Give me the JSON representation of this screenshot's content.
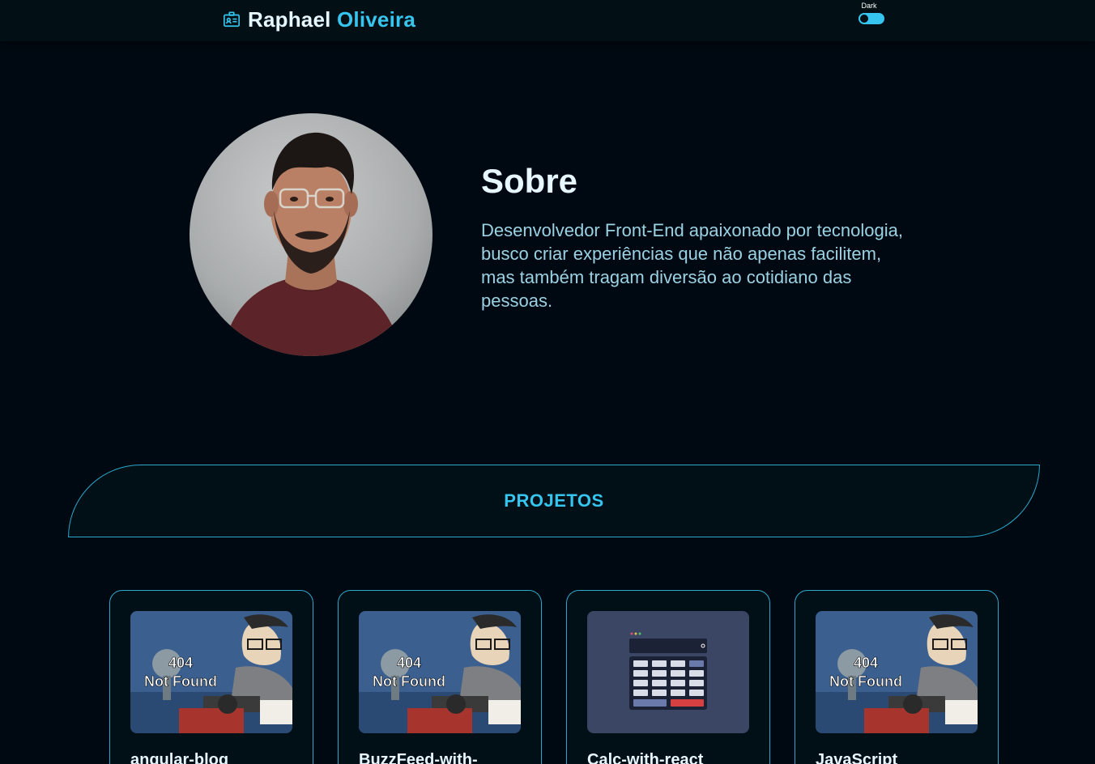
{
  "header": {
    "name_first": "Raphael",
    "name_last": "Oliveira",
    "logo_icon": "id-card-icon",
    "theme_label": "Dark",
    "theme_toggle_on": true,
    "accent_color": "#36c5ee"
  },
  "about": {
    "title": "Sobre",
    "description": "Desenvolvedor Front-End apaixonado por tecnologia, busco criar experiências que não apenas facilitem, mas também tragam diversão ao cotidiano das pessoas."
  },
  "projects": {
    "title": "PROJETOS",
    "cards": [
      {
        "title": "angular-blog",
        "image": "404-not-found",
        "image_text_1": "404",
        "image_text_2": "Not Found"
      },
      {
        "title": "BuzzFeed-with-",
        "image": "404-not-found",
        "image_text_1": "404",
        "image_text_2": "Not Found"
      },
      {
        "title": "Calc-with-react",
        "image": "calculator-screenshot"
      },
      {
        "title": "JavaScript",
        "image": "404-not-found",
        "image_text_1": "404",
        "image_text_2": "Not Found"
      }
    ]
  }
}
